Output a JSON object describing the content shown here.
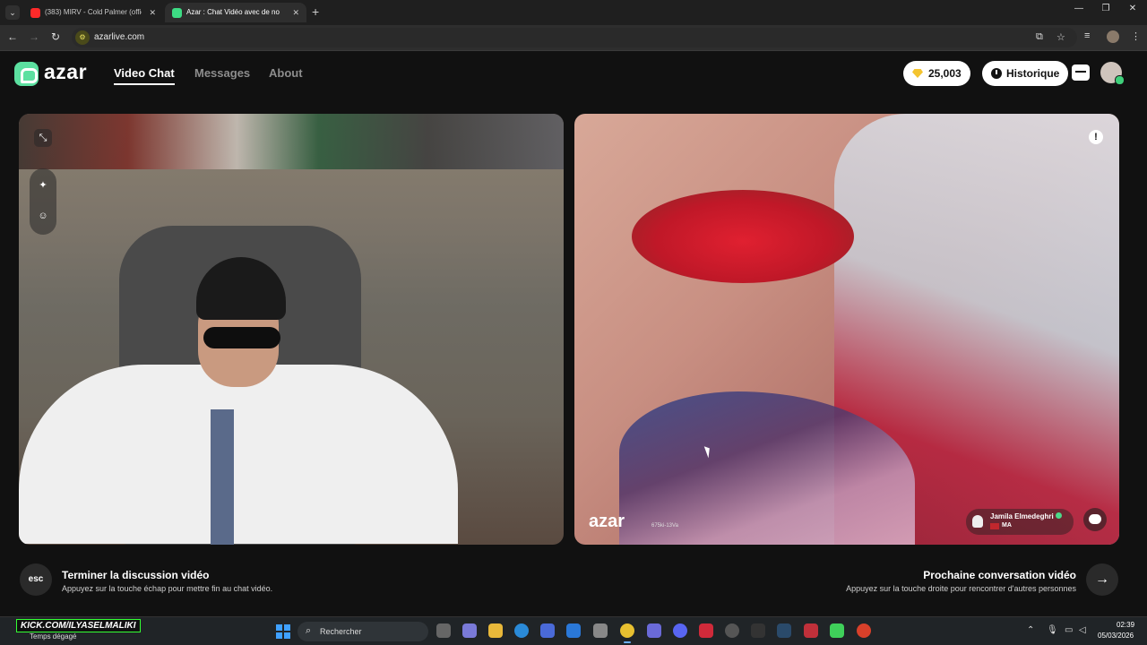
{
  "browser": {
    "tabs": [
      {
        "title": "(383) MIRV - Cold Palmer (offici",
        "favicon_color": "#ff2a2a"
      },
      {
        "title": "Azar : Chat Vidéo avec de no",
        "favicon_color": "#3ddc84"
      }
    ],
    "url": "azarlive.com"
  },
  "header": {
    "logo": "azar",
    "nav": [
      "Video Chat",
      "Messages",
      "About"
    ],
    "gems": "25,003",
    "history_label": "Historique"
  },
  "remote": {
    "watermark": "azar",
    "stream_id": "675ki-13Va",
    "user_name": "Jamila Elmedeghri",
    "country": "MA"
  },
  "footer": {
    "esc_key": "esc",
    "end_title": "Terminer la discussion vidéo",
    "end_sub": "Appuyez sur la touche échap pour mettre fin au chat vidéo.",
    "next_title": "Prochaine conversation vidéo",
    "next_sub": "Appuyez sur la touche droite pour rencontrer d'autres personnes"
  },
  "taskbar": {
    "overlay": "KICK.COM/ILYASELMALIKI",
    "weather": "Temps dégagé",
    "search_placeholder": "Rechercher",
    "time": "02:39",
    "date": "05/03/2026"
  },
  "colors": {
    "accent": "#5ce0a0",
    "gem": "#f4c430"
  }
}
